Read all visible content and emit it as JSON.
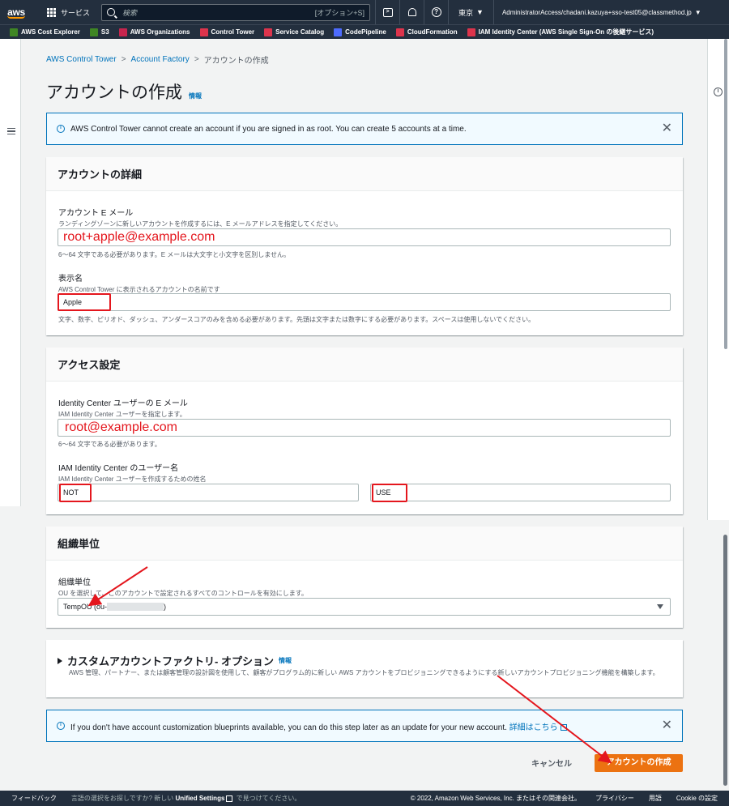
{
  "topnav": {
    "logo": "aws",
    "services_label": "サービス",
    "search_placeholder": "検索",
    "search_shortcut": "[オプション+S]",
    "region": "東京",
    "account": "AdministratorAccess/chadani.kazuya+sso-test05@classmethod.jp"
  },
  "favorites": [
    {
      "label": "AWS Cost Explorer",
      "color": "#3f8624"
    },
    {
      "label": "S3",
      "color": "#3f8624"
    },
    {
      "label": "AWS Organizations",
      "color": "#c7254e"
    },
    {
      "label": "Control Tower",
      "color": "#dd344c"
    },
    {
      "label": "Service Catalog",
      "color": "#dd344c"
    },
    {
      "label": "CodePipeline",
      "color": "#4d6bfe"
    },
    {
      "label": "CloudFormation",
      "color": "#dd344c"
    },
    {
      "label": "IAM Identity Center (AWS Single Sign-On の後継サービス)",
      "color": "#dd344c"
    }
  ],
  "breadcrumb": {
    "item1": "AWS Control Tower",
    "item2": "Account Factory",
    "current": "アカウントの作成"
  },
  "page": {
    "title": "アカウントの作成",
    "info": "情報"
  },
  "alert_top": {
    "text": "AWS Control Tower cannot create an account if you are signed in as root. You can create 5 accounts at a time."
  },
  "account_details": {
    "heading": "アカウントの詳細",
    "email_label": "アカウント E メール",
    "email_desc": "ランディングゾーンに新しいアカウントを作成するには、E メールアドレスを指定してください。",
    "email_value": "root+apple@example.com",
    "email_constraint": "6〜64 文字である必要があります。E メールは大文字と小文字を区別しません。",
    "display_label": "表示名",
    "display_desc": "AWS Control Tower に表示されるアカウントの名前です",
    "display_value": "Apple",
    "display_constraint": "文字、数字、ピリオド、ダッシュ、アンダースコアのみを含める必要があります。先頭は文字または数字にする必要があります。スペースは使用しないでください。"
  },
  "access": {
    "heading": "アクセス設定",
    "email_label": "Identity Center ユーザーの E メール",
    "email_desc": "IAM Identity Center ユーザーを指定します。",
    "email_value": "root@example.com",
    "email_constraint": "6〜64 文字である必要があります。",
    "username_label": "IAM Identity Center のユーザー名",
    "username_desc": "IAM Identity Center ユーザーを作成するための姓名",
    "first_name": "NOT",
    "last_name": "USE"
  },
  "ou": {
    "heading": "組織単位",
    "label": "組織単位",
    "desc": "OU を選択して、このアカウントで設定されるすべてのコントロールを有効にします。",
    "selected_prefix": "TempOU (ou-",
    "selected_suffix": ")"
  },
  "custom": {
    "heading": "カスタムアカウントファクトリ- オプション",
    "info": "情報",
    "desc": "AWS 管理、パートナー、または顧客管理の設計図を使用して、顧客がプログラム的に新しい AWS アカウントをプロビジョニングできるようにする新しいアカウントプロビジョニング機能を構築します。"
  },
  "alert_bottom": {
    "text": "If you don't have account customization blueprints available, you can do this step later as an update for your new account.",
    "link": "詳細はこちら"
  },
  "actions": {
    "cancel": "キャンセル",
    "create": "アカウントの作成"
  },
  "footer": {
    "feedback": "フィードバック",
    "lang_prefix": "言語の選択をお探しですか? 新しい",
    "lang_strong": "Unified Settings",
    "lang_suffix": "で見つけてください。",
    "copyright": "© 2022, Amazon Web Services, Inc. またはその関連会社。",
    "privacy": "プライバシー",
    "terms": "用語",
    "cookie": "Cookie の設定"
  },
  "colors": {
    "accent": "#0073bb",
    "primary_button": "#ec7211",
    "annotation": "#e4161d"
  }
}
